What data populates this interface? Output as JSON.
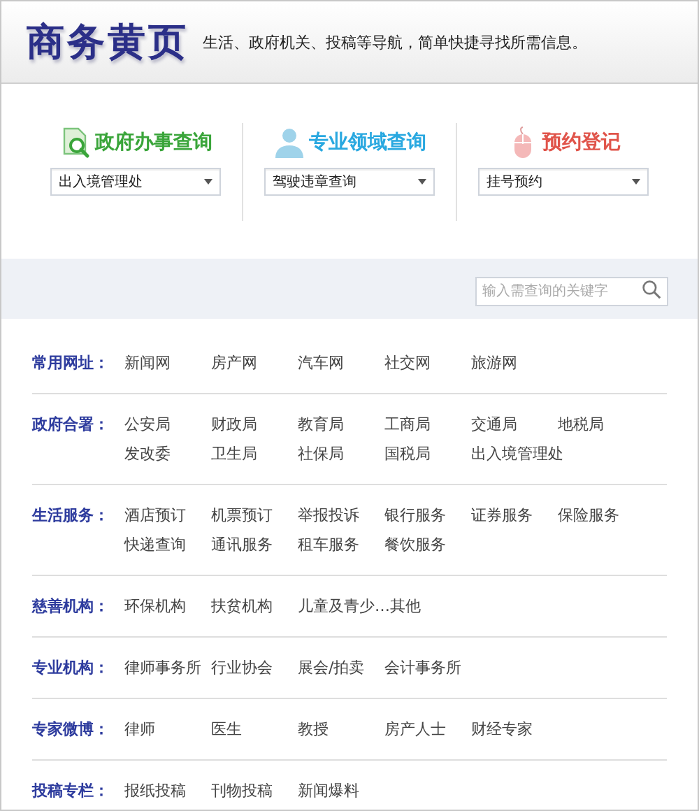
{
  "header": {
    "logo": "商务黄页",
    "tagline": "生活、政府机关、投稿等导航，简单快捷寻找所需信息。"
  },
  "queries": [
    {
      "kind": "document",
      "title": "政府办事查询",
      "color": "#3aa53a",
      "value": "出入境管理处"
    },
    {
      "kind": "person",
      "title": "专业领域查询",
      "color": "#29a8e0",
      "value": "驾驶违章查询"
    },
    {
      "kind": "mouse",
      "title": "预约登记",
      "color": "#e0544a",
      "value": "挂号预约"
    }
  ],
  "search": {
    "placeholder": "输入需查询的关键字"
  },
  "categories": [
    {
      "label": "常用网址：",
      "links": [
        "新闻网",
        "房产网",
        "汽车网",
        "社交网",
        "旅游网"
      ]
    },
    {
      "label": "政府合署：",
      "links": [
        "公安局",
        "财政局",
        "教育局",
        "工商局",
        "交通局",
        "地税局",
        "发改委",
        "卫生局",
        "社保局",
        "国税局",
        "出入境管理处"
      ]
    },
    {
      "label": "生活服务：",
      "links": [
        "酒店预订",
        "机票预订",
        "举报投诉",
        "银行服务",
        "证券服务",
        "保险服务",
        "快递查询",
        "通讯服务",
        "租车服务",
        "餐饮服务"
      ]
    },
    {
      "label": "慈善机构：",
      "links": [
        "环保机构",
        "扶贫机构",
        "儿童及青少…",
        "其他"
      ]
    },
    {
      "label": "专业机构：",
      "links": [
        "律师事务所",
        "行业协会",
        "展会/拍卖",
        "会计事务所"
      ]
    },
    {
      "label": "专家微博：",
      "links": [
        "律师",
        "医生",
        "教授",
        "房产人士",
        "财经专家"
      ]
    },
    {
      "label": "投稿专栏：",
      "links": [
        "报纸投稿",
        "刊物投稿",
        "新闻爆料"
      ]
    }
  ]
}
